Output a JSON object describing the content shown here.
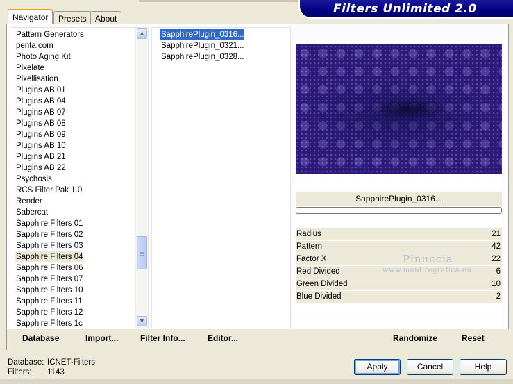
{
  "header": {
    "title": "Filters Unlimited 2.0"
  },
  "tabs": [
    {
      "label": "Navigator",
      "active": true
    },
    {
      "label": "Presets",
      "active": false
    },
    {
      "label": "About",
      "active": false
    }
  ],
  "categories": {
    "items": [
      "Pattern Generators",
      "penta.com",
      "Photo Aging Kit",
      "Pixelate",
      "Pixellisation",
      "Plugins AB 01",
      "Plugins AB 04",
      "Plugins AB 07",
      "Plugins AB 08",
      "Plugins AB 09",
      "Plugins AB 10",
      "Plugins AB 21",
      "Plugins AB 22",
      "Psychosis",
      "RCS Filter Pak 1.0",
      "Render",
      "Sabercat",
      "Sapphire Filters 01",
      "Sapphire Filters 02",
      "Sapphire Filters 03",
      "Sapphire Filters 04",
      "Sapphire Filters 06",
      "Sapphire Filters 07",
      "Sapphire Filters 10",
      "Sapphire Filters 11",
      "Sapphire Filters 12",
      "Sapphire Filters 1c"
    ],
    "selected": "Sapphire Filters 04"
  },
  "filters": {
    "items": [
      "SapphirePlugin_0316...",
      "SapphirePlugin_0321...",
      "SapphirePlugin_0328..."
    ],
    "selected": "SapphirePlugin_0316..."
  },
  "preview": {
    "filter_name": "SapphirePlugin_0316..."
  },
  "parameters": [
    {
      "name": "Radius",
      "value": "21"
    },
    {
      "name": "Pattern",
      "value": "42"
    },
    {
      "name": "Factor X",
      "value": "22"
    },
    {
      "name": "Red Divided",
      "value": "6"
    },
    {
      "name": "Green Divided",
      "value": "10"
    },
    {
      "name": "Blue Divided",
      "value": "2"
    }
  ],
  "watermark": {
    "line1": "Pinuccia",
    "line2": "www.maidiregrafica.eu"
  },
  "toolbar": {
    "database": "Database",
    "import": "Import...",
    "filter_info": "Filter Info...",
    "editor": "Editor...",
    "randomize": "Randomize",
    "reset": "Reset"
  },
  "status": {
    "database_label": "Database:",
    "database_value": "ICNET-Filters",
    "filters_label": "Filters:",
    "filters_value": "1143"
  },
  "buttons": {
    "apply": "Apply",
    "cancel": "Cancel",
    "help": "Help"
  },
  "colors": {
    "banner": "#000080",
    "selection": "#316ac5",
    "window_bg": "#ece9d8"
  }
}
